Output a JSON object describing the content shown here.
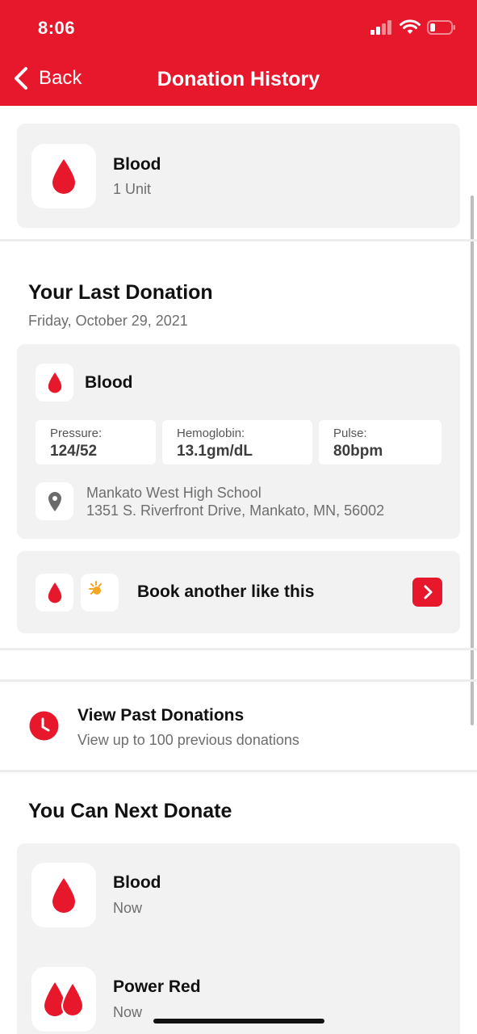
{
  "status": {
    "time": "8:06"
  },
  "nav": {
    "back_label": "Back",
    "title": "Donation History"
  },
  "summary": {
    "type": "Blood",
    "amount": "1 Unit"
  },
  "last_donation": {
    "heading": "Your Last Donation",
    "date": "Friday, October 29, 2021",
    "type": "Blood",
    "stats": [
      {
        "label": "Pressure:",
        "value": "124/52"
      },
      {
        "label": "Hemoglobin:",
        "value": "13.1gm/dL"
      },
      {
        "label": "Pulse:",
        "value": "80bpm"
      }
    ],
    "location_name": "Mankato West High School",
    "location_address": "1351 S. Riverfront Drive, Mankato, MN, 56002"
  },
  "book_again": {
    "label": "Book another like this"
  },
  "past": {
    "title": "View Past Donations",
    "subtitle": "View up to 100 previous donations"
  },
  "next": {
    "heading": "You Can Next Donate",
    "items": [
      {
        "type": "Blood",
        "when": "Now"
      },
      {
        "type": "Power Red",
        "when": "Now"
      }
    ]
  },
  "colors": {
    "brand_red": "#e8182c",
    "card_bg": "#f2f2f2",
    "text_gray": "#6e6e6e"
  }
}
